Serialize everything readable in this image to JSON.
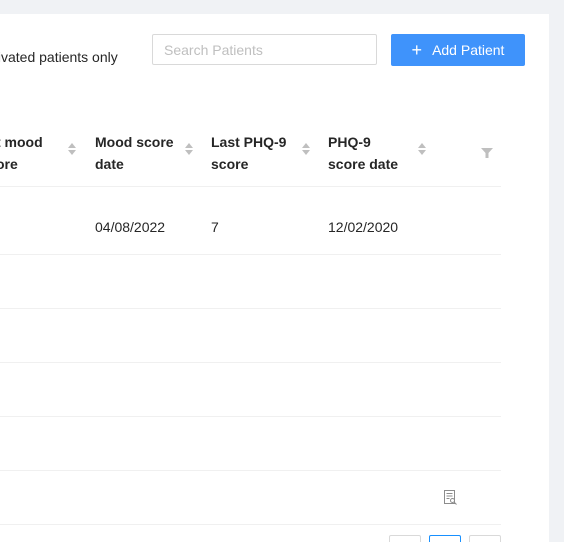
{
  "toolbar": {
    "activated_label": "tivated patients only",
    "search_placeholder": "Search Patients",
    "add_button_label": "Add Patient"
  },
  "table": {
    "columns": [
      {
        "line1": "t mood",
        "line2": "ore"
      },
      {
        "line1": "Mood score",
        "line2": "date"
      },
      {
        "line1": "Last PHQ-9",
        "line2": "score"
      },
      {
        "line1": "PHQ-9",
        "line2": "score date"
      }
    ],
    "rows": [
      {
        "mood_score_date": "04/08/2022",
        "last_phq9_score": "7",
        "phq9_score_date": "12/02/2020"
      }
    ]
  },
  "colors": {
    "primary": "#3f93fb",
    "background": "#f0f2f5"
  },
  "icons": [
    "plus-icon",
    "sort-icon",
    "filter-icon",
    "report-icon"
  ]
}
